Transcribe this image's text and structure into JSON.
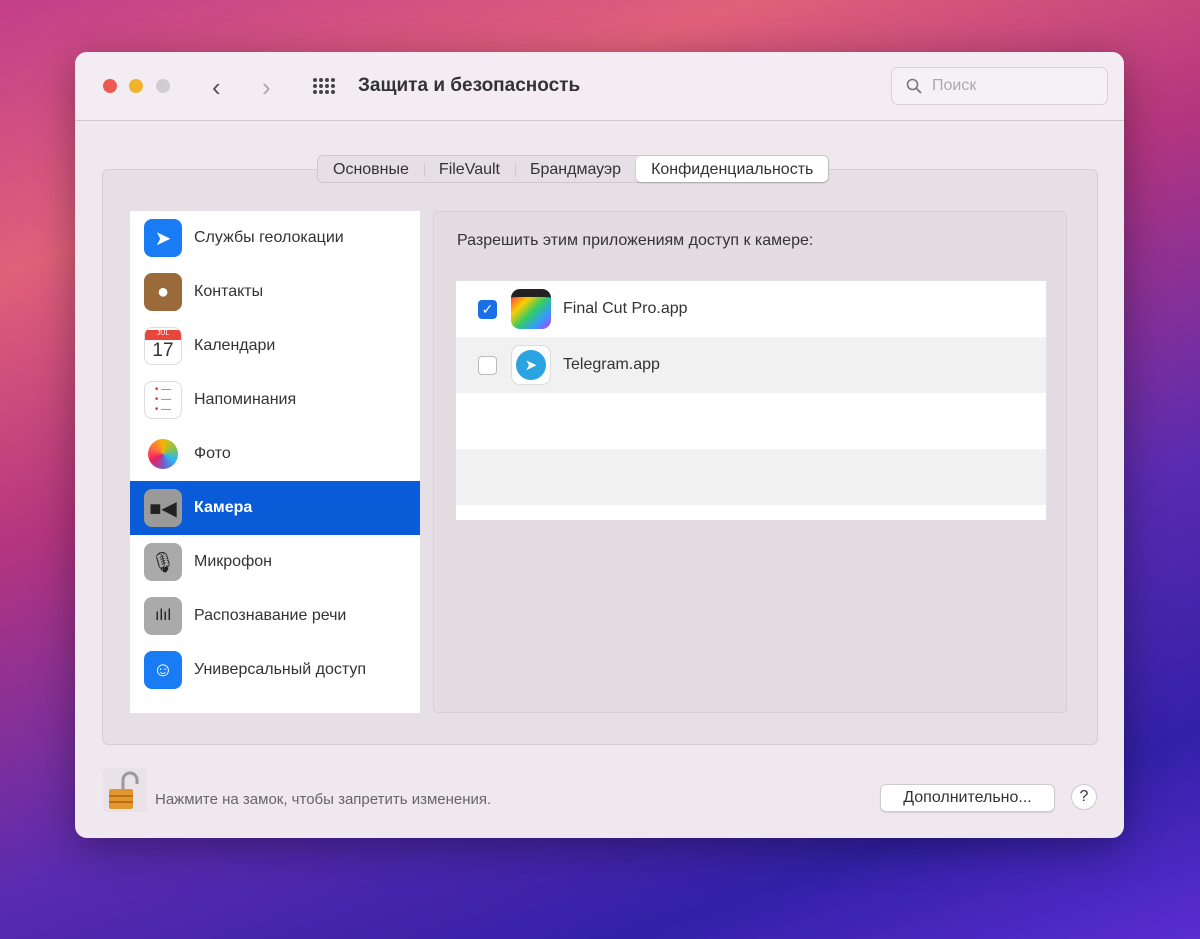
{
  "window": {
    "title": "Защита и безопасность",
    "search_placeholder": "Поиск"
  },
  "tabs": [
    "Основные",
    "FileVault",
    "Брандмауэр",
    "Конфиденциальность"
  ],
  "active_tab": 3,
  "sidebar": {
    "items": [
      {
        "label": "Службы геолокации",
        "icon": "location-arrow-icon"
      },
      {
        "label": "Контакты",
        "icon": "contacts-icon"
      },
      {
        "label": "Календари",
        "icon": "calendar-icon",
        "month": "JUL",
        "day": "17"
      },
      {
        "label": "Напоминания",
        "icon": "reminders-icon"
      },
      {
        "label": "Фото",
        "icon": "photos-icon"
      },
      {
        "label": "Камера",
        "icon": "camera-icon",
        "selected": true
      },
      {
        "label": "Микрофон",
        "icon": "microphone-icon"
      },
      {
        "label": "Распознавание речи",
        "icon": "speech-recognition-icon"
      },
      {
        "label": "Универсальный доступ",
        "icon": "accessibility-icon"
      }
    ]
  },
  "main": {
    "label": "Разрешить этим приложениям доступ к камере:",
    "apps": [
      {
        "name": "Final Cut Pro.app",
        "checked": true
      },
      {
        "name": "Telegram.app",
        "checked": false
      }
    ]
  },
  "footer": {
    "lock_text": "Нажмите на замок, чтобы запретить изменения.",
    "advanced_button": "Дополнительно...",
    "help": "?"
  },
  "colors": {
    "accent": "#0a5bd8"
  }
}
